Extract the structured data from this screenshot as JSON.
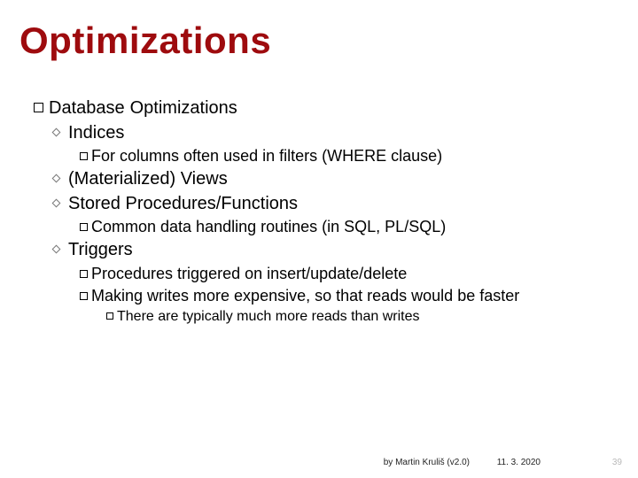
{
  "title": "Optimizations",
  "l1": {
    "a": "Database",
    "b": "Optimizations"
  },
  "indices": {
    "label": "Indices",
    "sub1": "For columns often used in filters (WHERE clause)"
  },
  "views": {
    "label": "(Materialized) Views"
  },
  "procs": {
    "label": "Stored Procedures/Functions",
    "sub1": "Common data handling routines (in SQL, PL/SQL)"
  },
  "triggers": {
    "label": "Triggers",
    "sub1": "Procedures triggered on insert/update/delete",
    "sub2": "Making writes more expensive, so that reads would be faster",
    "sub2a": "There are typically much more reads than writes"
  },
  "footer": {
    "author": "by Martin Kruliš (v2.0)",
    "date": "11. 3. 2020",
    "page": "39"
  }
}
